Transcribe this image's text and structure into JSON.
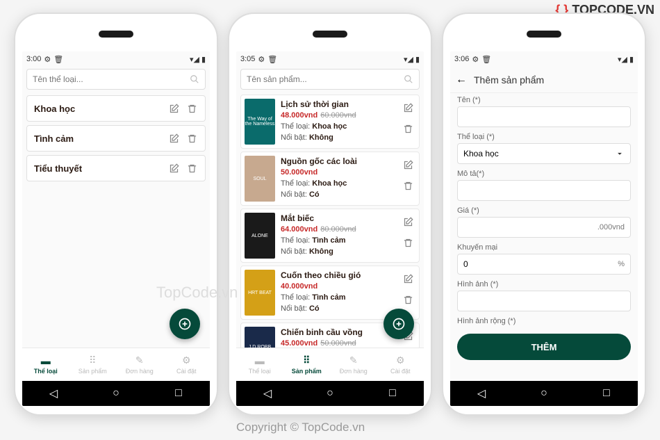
{
  "branding": {
    "logo_text": "TOPCODE.VN"
  },
  "watermarks": {
    "center": "TopCode.vn",
    "footer": "Copyright © TopCode.vn"
  },
  "nav": {
    "items": [
      {
        "label": "Thể loại"
      },
      {
        "label": "Sản phẩm"
      },
      {
        "label": "Đơn hàng"
      },
      {
        "label": "Cài đặt"
      }
    ]
  },
  "screen1": {
    "time": "3:00",
    "search_placeholder": "Tên thể loại...",
    "categories": [
      {
        "name": "Khoa học"
      },
      {
        "name": "Tình cảm"
      },
      {
        "name": "Tiểu thuyết"
      }
    ]
  },
  "screen2": {
    "time": "3:05",
    "search_placeholder": "Tên sản phẩm...",
    "meta_labels": {
      "category": "Thể loại:",
      "featured": "Nổi bật:"
    },
    "products": [
      {
        "title": "Lịch sử thời gian",
        "price": "48.000vnd",
        "price_old": "60.000vnd",
        "category": "Khoa học",
        "featured": "Không",
        "thumb": "The Way of the Nameless",
        "bg": "#0a6b6b"
      },
      {
        "title": "Nguồn gốc các loài",
        "price": "50.000vnd",
        "price_old": "",
        "category": "Khoa học",
        "featured": "Có",
        "thumb": "SOUL",
        "bg": "#c7a98f"
      },
      {
        "title": "Mắt biếc",
        "price": "64.000vnd",
        "price_old": "80.000vnd",
        "category": "Tình cảm",
        "featured": "Không",
        "thumb": "ALONE",
        "bg": "#1a1a1a"
      },
      {
        "title": "Cuốn theo chiều gió",
        "price": "40.000vnd",
        "price_old": "",
        "category": "Tình cảm",
        "featured": "Có",
        "thumb": "HRT BEAT",
        "bg": "#d4a017"
      },
      {
        "title": "Chiến binh cầu vồng",
        "price": "45.000vnd",
        "price_old": "50.000vnd",
        "category": "",
        "featured": "",
        "thumb": "J.D.ROBB PASSIONS",
        "bg": "#1a2a4a"
      }
    ]
  },
  "screen3": {
    "time": "3:06",
    "header_title": "Thêm sản phẩm",
    "form": {
      "name_label": "Tên (*)",
      "category_label": "Thể loại (*)",
      "category_value": "Khoa học",
      "desc_label": "Mô tả(*)",
      "price_label": "Giá (*)",
      "price_suffix": ".000vnd",
      "promo_label": "Khuyến mại",
      "promo_value": "0",
      "promo_suffix": "%",
      "image_label": "Hình ảnh (*)",
      "image_wide_label": "Hình ảnh rộng (*)",
      "submit": "THÊM"
    }
  }
}
